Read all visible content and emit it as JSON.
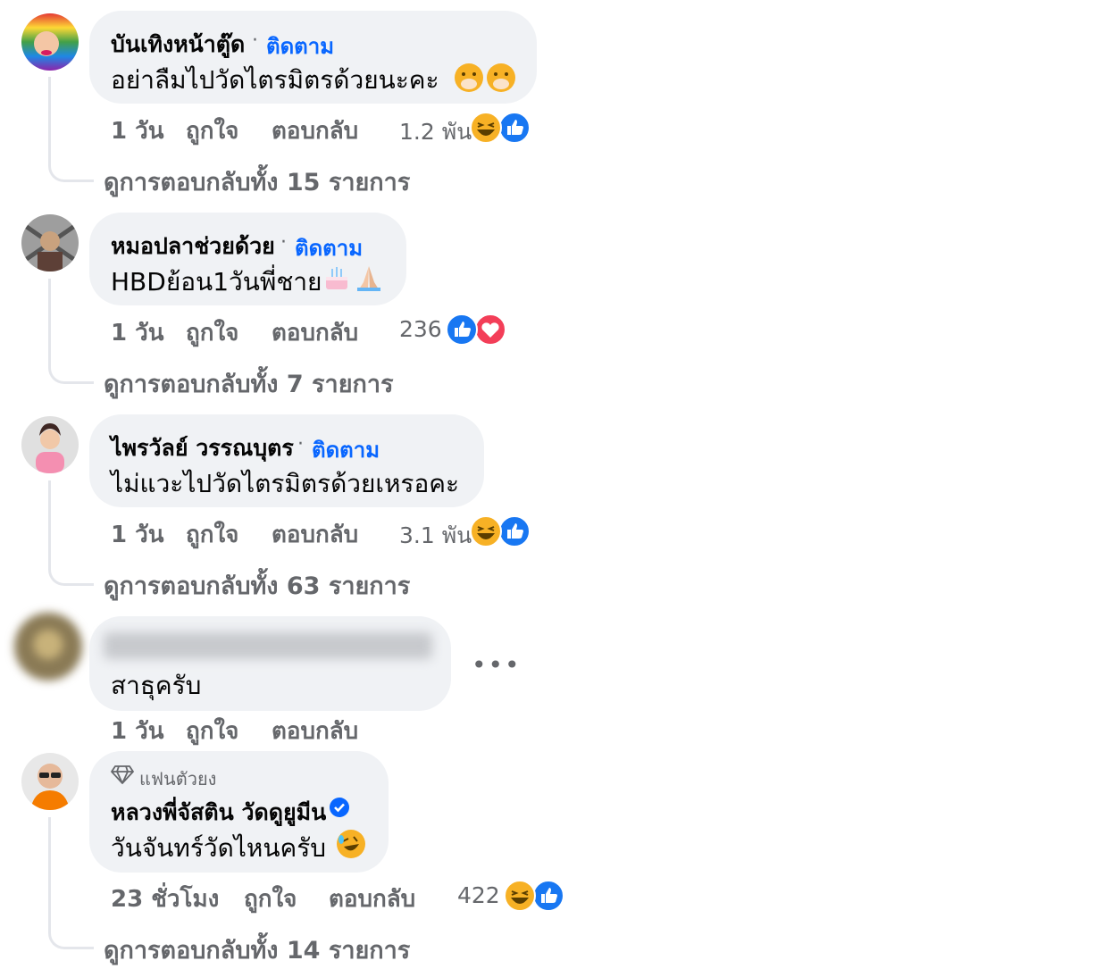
{
  "comments": [
    {
      "name": "บันเทิงหน้าตู๊ด",
      "follow": "ติดตาม",
      "text": "อย่าลืมไปวัดไตรมิตรด้วยนะคะ",
      "time": "1 วัน",
      "like": "ถูกใจ",
      "reply": "ตอบกลับ",
      "reactions": "1.2 พัน",
      "view_replies": "ดูการตอบกลับทั้ง 15 รายการ"
    },
    {
      "name": "หมอปลาช่วยด้วย",
      "follow": "ติดตาม",
      "text": "HBDย้อน1วันพี่ชาย",
      "time": "1 วัน",
      "like": "ถูกใจ",
      "reply": "ตอบกลับ",
      "reactions": "236",
      "view_replies": "ดูการตอบกลับทั้ง 7 รายการ"
    },
    {
      "name": "ไพรวัลย์ วรรณบุตร",
      "follow": "ติดตาม",
      "text": "ไม่แวะไปวัดไตรมิตรด้วยเหรอคะ",
      "time": "1 วัน",
      "like": "ถูกใจ",
      "reply": "ตอบกลับ",
      "reactions": "3.1 พัน",
      "view_replies": "ดูการตอบกลับทั้ง 63 รายการ"
    },
    {
      "text": "สาธุครับ",
      "time": "1 วัน",
      "like": "ถูกใจ",
      "reply": "ตอบกลับ",
      "more": "•••"
    },
    {
      "badge": "แฟนตัวยง",
      "name": "หลวงพี่จัสติน วัดดูยูมีน",
      "text": "วันจันทร์วัดไหนครับ",
      "time": "23 ชั่วโมง",
      "like": "ถูกใจ",
      "reply": "ตอบกลับ",
      "reactions": "422",
      "view_replies": "ดูการตอบกลับทั้ง 14 รายการ"
    }
  ],
  "colors": {
    "bubble": "#f0f2f5",
    "link_blue": "#0866ff",
    "meta_gray": "#65676b",
    "like_blue": "#1877f2",
    "love_red": "#f33e58",
    "haha_yellow": "#f7b125"
  }
}
